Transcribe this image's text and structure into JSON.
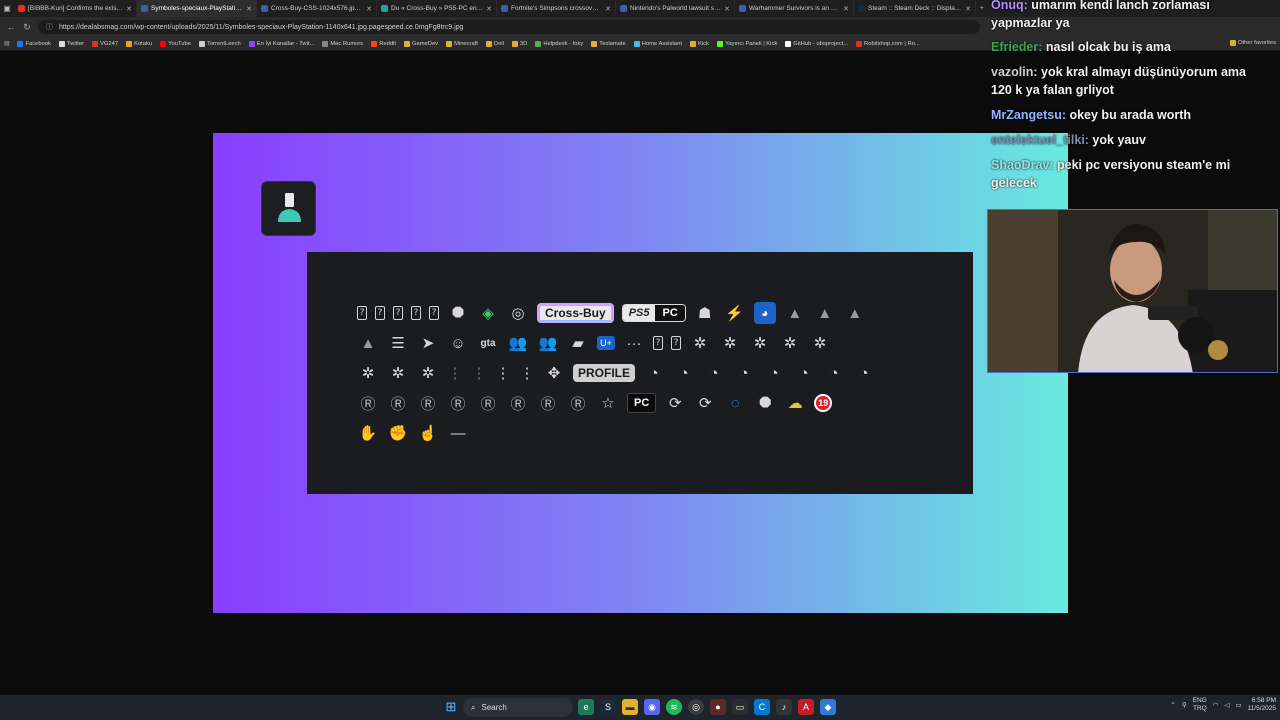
{
  "browser": {
    "tabs": [
      {
        "title": "[BIBBB-Kun] Confirms the existen",
        "color": "#e0302e"
      },
      {
        "title": "Symboles-speciaux-PlayStation-1",
        "color": "#3a5fb0"
      },
      {
        "title": "Cross-Buy-CSS-1024x576.jpg.pag",
        "color": "#3a5fb0"
      },
      {
        "title": "Du « Cross-Buy » PS5-PC en prép",
        "color": "#2aa198"
      },
      {
        "title": "Fortnite's Simpsons crossover ear",
        "color": "#3a5fb0"
      },
      {
        "title": "Nintendo's Palworld lawsuit suffe",
        "color": "#3a5fb0"
      },
      {
        "title": "Warhammer Survivors is an officia",
        "color": "#3a5fb0"
      },
      {
        "title": "Steam :: Steam Deck :: Display-Of",
        "color": "#1b2838"
      }
    ],
    "url": "https://dealabsmag.com/wp-content/uploads/2025/11/Symboles-speciaux-PlayStation-1140x641.jpg.pagespeed.ce.0mgFg8trc9.jpg",
    "bookmarks": [
      {
        "label": "Facebook",
        "color": "#1877f2"
      },
      {
        "label": "Twitter",
        "color": "#dddddd"
      },
      {
        "label": "VG247",
        "color": "#e0302e"
      },
      {
        "label": "Kotaku",
        "color": "#f0a020"
      },
      {
        "label": "YouTube",
        "color": "#ff0000"
      },
      {
        "label": "TorrentLeech",
        "color": "#cccccc"
      },
      {
        "label": "En İyi Kanallar - Twit...",
        "color": "#9146ff"
      },
      {
        "label": "Mac Rumors",
        "color": "#888888"
      },
      {
        "label": "Reddit",
        "color": "#ff4500"
      },
      {
        "label": "GameDev",
        "color": "#e0b030"
      },
      {
        "label": "Minecraft",
        "color": "#e0b030"
      },
      {
        "label": "Dell",
        "color": "#e0b030"
      },
      {
        "label": "3D",
        "color": "#e0b030"
      },
      {
        "label": "Helpdesk - foky",
        "color": "#4caf50"
      },
      {
        "label": "Teslamate",
        "color": "#e0b030"
      },
      {
        "label": "Home Assistant",
        "color": "#41bdf5"
      },
      {
        "label": "Kick",
        "color": "#e0b030"
      },
      {
        "label": "Yayıncı Paneli | Kick",
        "color": "#53fc18"
      },
      {
        "label": "GitHub - obsproject...",
        "color": "#ffffff"
      },
      {
        "label": "Robitshop.com | Ro...",
        "color": "#e0302e"
      }
    ],
    "other_bookmarks": "Other favorites"
  },
  "panel": {
    "cross_buy": "Cross-Buy",
    "ps5": "PS5",
    "pc": "PC",
    "profile": "PROFILE",
    "pc2": "PC",
    "age": "19",
    "ps_plus": "U+"
  },
  "chat": [
    {
      "user": "Onuq:",
      "text": " umarım kendi lanch zorlaması yapmazlar ya",
      "color": "#b58cff"
    },
    {
      "user": "Efrieder:",
      "text": " nasıl olcak bu iş ama",
      "color": "#3aa55a"
    },
    {
      "user": "vazolin:",
      "text": " yok kral almayı düşünüyorum ama 120 k ya falan grliyot",
      "color": "#cfcfcf"
    },
    {
      "user": "MrZangetsu:",
      "text": " okey bu arada worth",
      "color": "#8fb6ff"
    },
    {
      "user": "entelektuel_tilki:",
      "text": " yok yauv",
      "color": "#7a8fb0"
    },
    {
      "user": "ShaoDrav:",
      "text": " peki pc versiyonu steam'e mi gelecek",
      "color": "#9adfe0"
    }
  ],
  "taskbar": {
    "search": "Search",
    "lang1": "ENG",
    "lang2": "TRQ",
    "time": "6:58 PM",
    "date": "11/5/2025"
  }
}
